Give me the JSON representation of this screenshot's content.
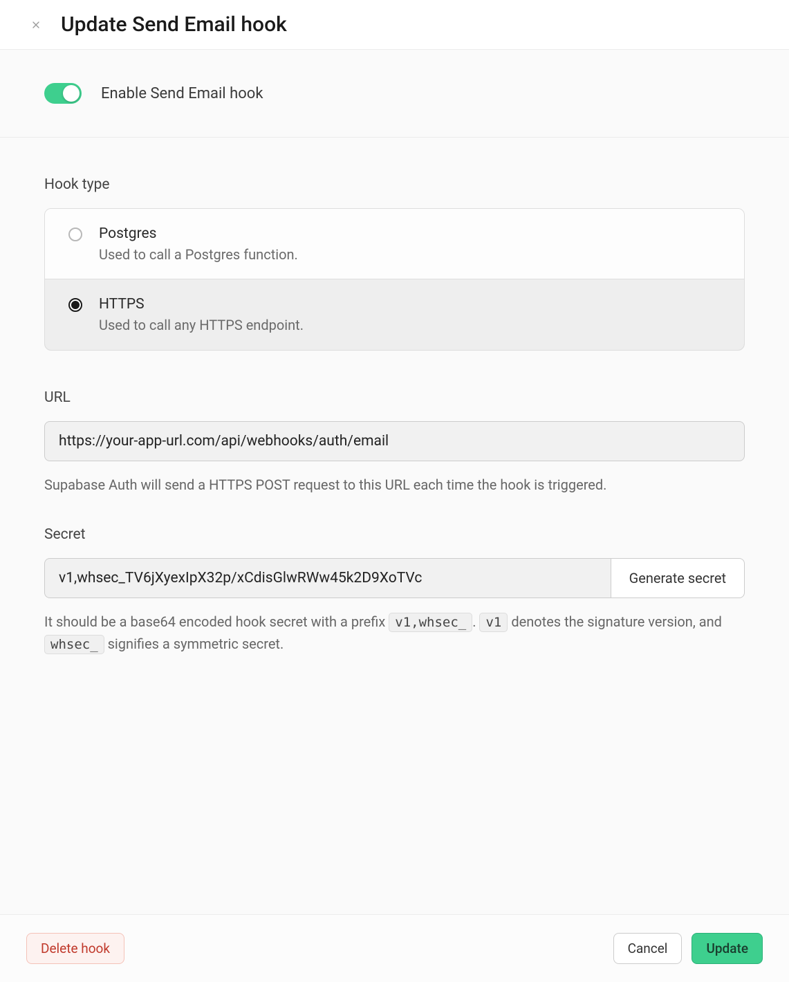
{
  "header": {
    "title": "Update Send Email hook"
  },
  "enable": {
    "label": "Enable Send Email hook",
    "on": true
  },
  "hook_type": {
    "label": "Hook type",
    "options": [
      {
        "title": "Postgres",
        "description": "Used to call a Postgres function.",
        "selected": false
      },
      {
        "title": "HTTPS",
        "description": "Used to call any HTTPS endpoint.",
        "selected": true
      }
    ]
  },
  "url": {
    "label": "URL",
    "value": "https://your-app-url.com/api/webhooks/auth/email",
    "help": "Supabase Auth will send a HTTPS POST request to this URL each time the hook is triggered."
  },
  "secret": {
    "label": "Secret",
    "value": "v1,whsec_TV6jXyexIpX32p/xCdisGlwRWw45k2D9XoTVc",
    "generate_label": "Generate secret",
    "help_prefix": "It should be a base64 encoded hook secret with a prefix ",
    "help_code1": "v1,whsec_",
    "help_mid1": ". ",
    "help_code2": "v1",
    "help_mid2": " denotes the signature version, and ",
    "help_code3": "whsec_",
    "help_suffix": " signifies a symmetric secret."
  },
  "footer": {
    "delete_label": "Delete hook",
    "cancel_label": "Cancel",
    "update_label": "Update"
  }
}
